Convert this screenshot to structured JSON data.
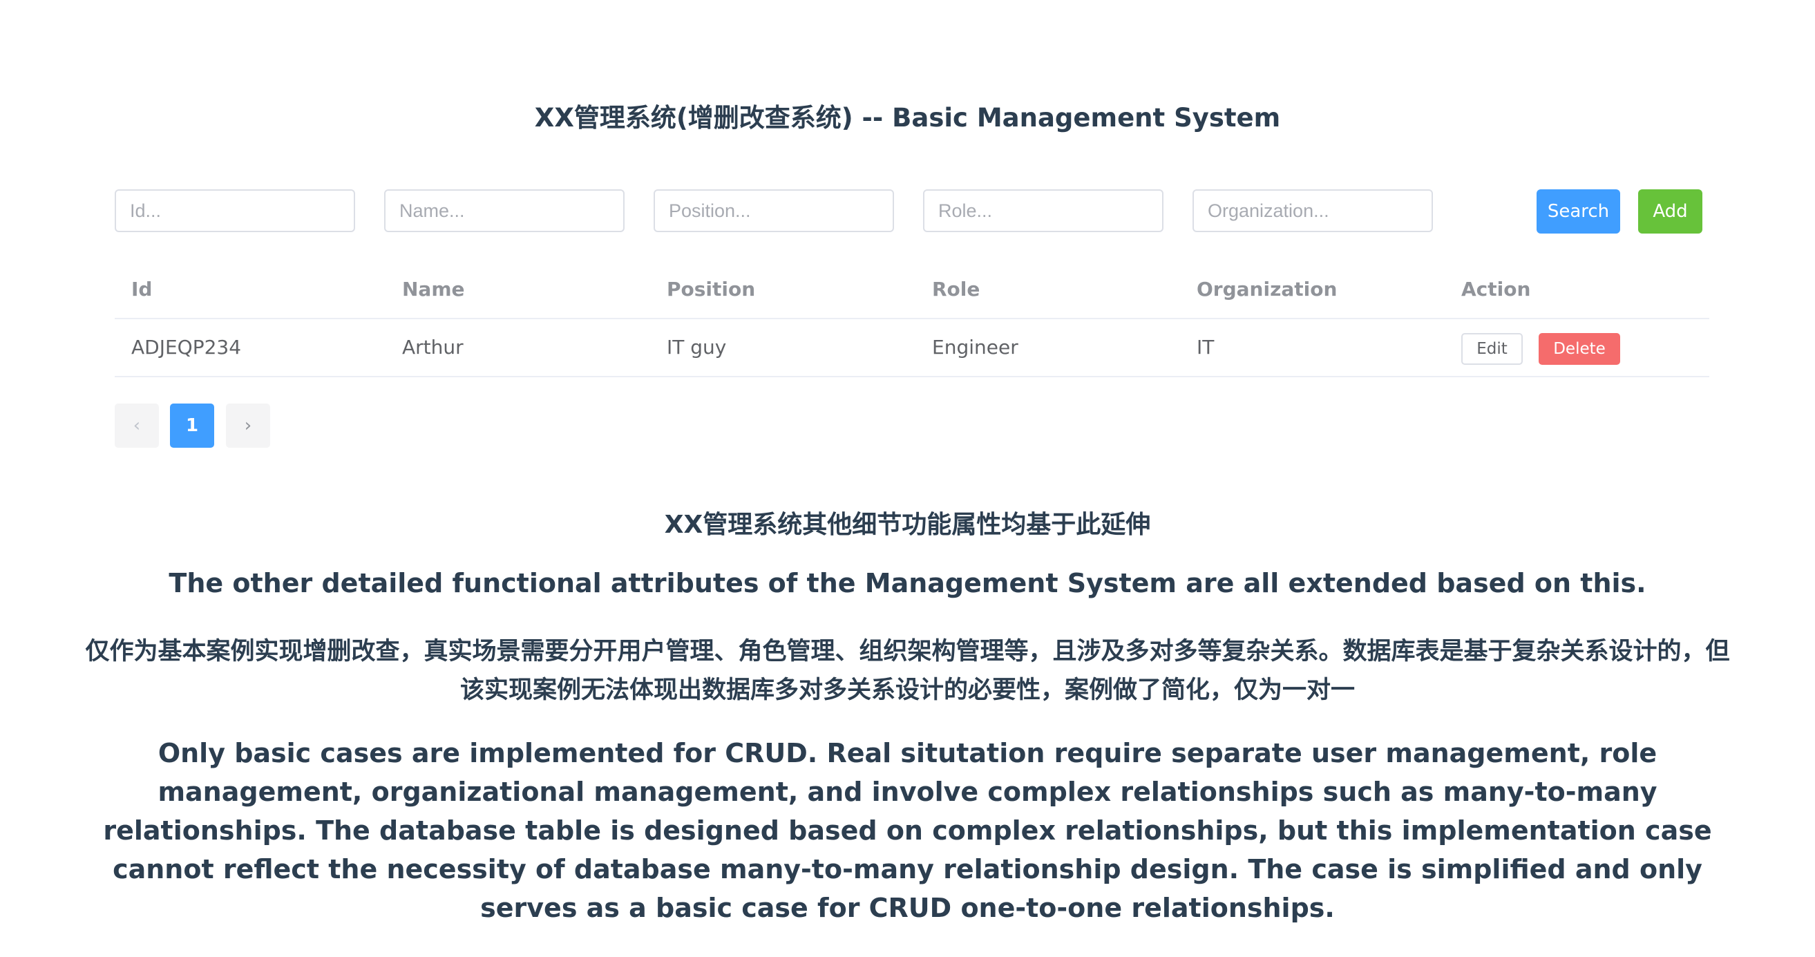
{
  "title": "XX管理系统(增删改查系统) -- Basic Management System",
  "filters": {
    "id_placeholder": "Id...",
    "name_placeholder": "Name...",
    "position_placeholder": "Position...",
    "role_placeholder": "Role...",
    "organization_placeholder": "Organization...",
    "search_label": "Search",
    "add_label": "Add"
  },
  "colors": {
    "primary": "#409eff",
    "success": "#67c23a",
    "danger": "#f56c6c"
  },
  "table": {
    "columns": [
      "Id",
      "Name",
      "Position",
      "Role",
      "Organization",
      "Action"
    ],
    "rows": [
      {
        "id": "ADJEQP234",
        "name": "Arthur",
        "position": "IT guy",
        "role": "Engineer",
        "organization": "IT",
        "edit_label": "Edit",
        "delete_label": "Delete"
      }
    ]
  },
  "pagination": {
    "prev_icon": "‹",
    "current_page": "1",
    "next_icon": "›"
  },
  "notes": {
    "zh_1": "XX管理系统其他细节功能属性均基于此延伸",
    "en_1": "The other detailed functional attributes of the Management System are all extended based on this.",
    "zh_2": "仅作为基本案例实现增删改查，真实场景需要分开用户管理、角色管理、组织架构管理等，且涉及多对多等复杂关系。数据库表是基于复杂关系设计的，但该实现案例无法体现出数据库多对多关系设计的必要性，案例做了简化，仅为一对一",
    "en_2": "Only basic cases are implemented for CRUD. Real situtation require separate user management, role management, organizational management, and involve complex relationships such as many-to-many relationships. The database table is designed based on complex relationships, but this implementation case cannot reflect the necessity of database many-to-many relationship design. The case is simplified and only serves as a basic case for CRUD one-to-one relationships."
  }
}
